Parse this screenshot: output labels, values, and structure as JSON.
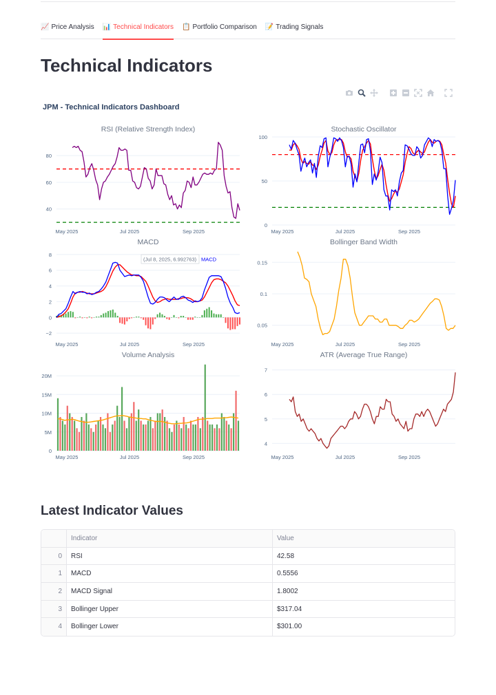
{
  "tabs": [
    {
      "icon": "📈",
      "label": "Price Analysis"
    },
    {
      "icon": "📊",
      "label": "Technical Indicators"
    },
    {
      "icon": "📋",
      "label": "Portfolio Comparison"
    },
    {
      "icon": "📝",
      "label": "Trading Signals"
    }
  ],
  "active_tab": 1,
  "page_title": "Technical Indicators",
  "dashboard_title": "JPM - Technical Indicators Dashboard",
  "modebar_icons": [
    "camera-icon",
    "zoom-icon",
    "pan-icon",
    "zoom-in-icon",
    "zoom-out-icon",
    "autoscale-icon",
    "reset-axes-icon",
    "fullscreen-icon"
  ],
  "hover_tooltip": {
    "text": "(Jul 8, 2025, 6.992763)",
    "series": "MACD"
  },
  "colors": {
    "accent": "#ff4b4b",
    "rsi": "#800080",
    "stoch_k": "#0000ff",
    "stoch_d": "#ff0000",
    "macd": "#0000ff",
    "signal": "#ff0000",
    "hist_pos": "#4caf50",
    "hist_neg": "#ff5252",
    "bbw": "#ffa500",
    "volume_ma": "#ffa500",
    "atr": "#a52a2a",
    "overbought": "#ff0000",
    "oversold": "#008000"
  },
  "chart_data": [
    {
      "type": "line",
      "title": "RSI (Relative Strength Index)",
      "x_ticks": [
        "May 2025",
        "Jul 2025",
        "Sep 2025"
      ],
      "y_ticks": [
        40,
        60,
        80
      ],
      "ylim": [
        28,
        94
      ],
      "reference_lines": [
        {
          "value": 70,
          "color": "#ff0000",
          "style": "dashed"
        },
        {
          "value": 30,
          "color": "#008000",
          "style": "dashed"
        }
      ],
      "series": [
        {
          "values": [
            86,
            87,
            86,
            87,
            84,
            83,
            75,
            64,
            66,
            71,
            74,
            69,
            62,
            58,
            47,
            55,
            60,
            61,
            64,
            66,
            69,
            72,
            74,
            79,
            86,
            84,
            84,
            85,
            84,
            69,
            69,
            61,
            60,
            56,
            55,
            57,
            64,
            71,
            70,
            63,
            61,
            55,
            58,
            70,
            65,
            65,
            65,
            59,
            58,
            51,
            47,
            50,
            43,
            44,
            40,
            43,
            41,
            52,
            54,
            61,
            60,
            56,
            64,
            58,
            58,
            60,
            63,
            66,
            67,
            66,
            66,
            67,
            66,
            69,
            70,
            90,
            88,
            84,
            65,
            57,
            52,
            53,
            41,
            34,
            33,
            44,
            39
          ]
        }
      ]
    },
    {
      "type": "line",
      "title": "Stochastic Oscillator",
      "x_ticks": [
        "May 2025",
        "Jul 2025",
        "Sep 2025"
      ],
      "y_ticks": [
        0,
        50,
        100
      ],
      "ylim": [
        0,
        100
      ],
      "reference_lines": [
        {
          "value": 80,
          "color": "#ff0000",
          "style": "dashed"
        },
        {
          "value": 20,
          "color": "#008000",
          "style": "dashed"
        }
      ],
      "series": [
        {
          "values": [
            91,
            86,
            96,
            93,
            86,
            80,
            61,
            70,
            76,
            66,
            71,
            74,
            59,
            70,
            54,
            78,
            90,
            88,
            98,
            99,
            66,
            77,
            86,
            99,
            98,
            95,
            99,
            96,
            88,
            66,
            78,
            78,
            69,
            43,
            58,
            49,
            71,
            91,
            92,
            82,
            97,
            98,
            84,
            46,
            58,
            51,
            60,
            77,
            71,
            40,
            33,
            33,
            17,
            40,
            38,
            40,
            33,
            49,
            59,
            62,
            91,
            90,
            86,
            81,
            79,
            79,
            89,
            86,
            76,
            79,
            91,
            95,
            99,
            97,
            89,
            97,
            95,
            96,
            94,
            85,
            64,
            64,
            33,
            12,
            19,
            28,
            51
          ]
        },
        {
          "values": [
            85,
            85,
            91,
            93,
            90,
            86,
            75,
            70,
            72,
            70,
            69,
            72,
            68,
            68,
            63,
            68,
            78,
            85,
            93,
            96,
            84,
            80,
            82,
            91,
            96,
            97,
            97,
            97,
            93,
            83,
            77,
            78,
            75,
            61,
            55,
            50,
            59,
            74,
            85,
            89,
            93,
            96,
            92,
            75,
            62,
            52,
            56,
            63,
            69,
            62,
            47,
            35,
            27,
            30,
            35,
            39,
            37,
            41,
            49,
            57,
            71,
            81,
            89,
            87,
            82,
            80,
            83,
            85,
            83,
            81,
            83,
            89,
            94,
            97,
            94,
            93,
            95,
            96,
            95,
            91,
            80,
            70,
            52,
            36,
            24,
            20,
            33
          ]
        }
      ]
    },
    {
      "type": "line",
      "title": "MACD",
      "x_ticks": [
        "May 2025",
        "Jul 2025",
        "Sep 2025"
      ],
      "y_ticks": [
        -2,
        0,
        2,
        4,
        6,
        8
      ],
      "ylim": [
        -2.6,
        8.6
      ],
      "series": [
        {
          "name": "MACD",
          "values": [
            0,
            0.4,
            0.5,
            0.8,
            1.1,
            1.8,
            2.6,
            3.3,
            3.0,
            3.2,
            3.3,
            3.2,
            3.2,
            3.0,
            3.1,
            2.9,
            3.0,
            3.2,
            3.3,
            3.6,
            4.0,
            4.5,
            5.3,
            6.1,
            6.9,
            7.0,
            6.9,
            6.0,
            5.6,
            5.2,
            5.3,
            5.4,
            5.3,
            5.4,
            5.4,
            5.4,
            5.1,
            4.6,
            3.6,
            2.6,
            1.8,
            1.7,
            1.9,
            2.3,
            2.6,
            2.6,
            2.5,
            2.2,
            2.0,
            2.3,
            2.6,
            2.3,
            2.3,
            2.6,
            2.7,
            2.5,
            2.2,
            2.1,
            1.9,
            2.1,
            2.0,
            2.1,
            2.5,
            3.5,
            4.3,
            5.1,
            5.3,
            5.3,
            5.3,
            5.3,
            5.2,
            4.6,
            3.7,
            2.6,
            1.8,
            1.3,
            0.6,
            0.5,
            0.6
          ]
        },
        {
          "name": "Signal",
          "values": [
            0,
            0.1,
            0.2,
            0.4,
            0.7,
            1.1,
            1.8,
            2.6,
            3.1,
            3.2,
            3.2,
            3.3,
            3.2,
            3.1,
            3.0,
            3.0,
            3.0,
            3.1,
            3.2,
            3.3,
            3.5,
            3.9,
            4.5,
            5.2,
            5.9,
            6.4,
            6.7,
            6.7,
            6.4,
            6.1,
            5.8,
            5.6,
            5.4,
            5.4,
            5.3,
            5.3,
            5.2,
            4.9,
            4.6,
            4.0,
            3.3,
            2.6,
            2.1,
            1.9,
            2.0,
            2.2,
            2.3,
            2.4,
            2.3,
            2.3,
            2.3,
            2.3,
            2.4,
            2.4,
            2.5,
            2.5,
            2.5,
            2.4,
            2.2,
            2.0,
            2.0,
            2.1,
            2.2,
            2.6,
            3.2,
            3.8,
            4.4,
            4.8,
            4.9,
            4.9,
            4.8,
            4.6,
            4.4,
            4.0,
            3.4,
            2.8,
            2.1,
            1.6,
            1.5
          ]
        },
        {
          "name": "Histogram",
          "values": [
            0.2,
            0.3,
            0.3,
            0.4,
            0.5,
            0.7,
            0.8,
            0.7,
            -0.1,
            0,
            0.1,
            -0.1,
            0,
            -0.1,
            0.1,
            -0.1,
            0,
            0.1,
            0.1,
            0.3,
            0.5,
            0.6,
            0.8,
            0.9,
            1.0,
            0.6,
            0.2,
            -0.7,
            -0.8,
            -0.9,
            -0.5,
            -0.2,
            -0.1,
            0,
            0.1,
            0.1,
            -0.1,
            -0.3,
            -1.0,
            -1.4,
            -1.5,
            -0.9,
            -0.2,
            0.4,
            0.6,
            0.4,
            0.2,
            -0.2,
            -0.3,
            0,
            0.3,
            0,
            -0.1,
            0.2,
            0.2,
            0,
            -0.3,
            -0.3,
            -0.3,
            0.1,
            0,
            0,
            0.3,
            0.9,
            1.1,
            1.3,
            0.9,
            0.5,
            0.4,
            0.4,
            0.4,
            0,
            -0.7,
            -1.4,
            -1.6,
            -1.5,
            -1.5,
            -1.1,
            -0.9
          ]
        }
      ]
    },
    {
      "type": "line",
      "title": "Bollinger Band Width",
      "x_ticks": [
        "May 2025",
        "Jul 2025",
        "Sep 2025"
      ],
      "y_ticks": [
        0.05,
        0.1,
        0.15
      ],
      "ylim": [
        0.03,
        0.17
      ],
      "series": [
        {
          "values": [
            0.167,
            0.158,
            0.145,
            0.125,
            0.123,
            0.119,
            0.1,
            0.09,
            0.08,
            0.06,
            0.045,
            0.035,
            0.037,
            0.037,
            0.04,
            0.05,
            0.06,
            0.08,
            0.105,
            0.125,
            0.155,
            0.155,
            0.145,
            0.125,
            0.095,
            0.07,
            0.06,
            0.05,
            0.05,
            0.055,
            0.06,
            0.065,
            0.065,
            0.065,
            0.06,
            0.06,
            0.055,
            0.055,
            0.06,
            0.06,
            0.05,
            0.05,
            0.05,
            0.05,
            0.048,
            0.045,
            0.045,
            0.05,
            0.053,
            0.058,
            0.058,
            0.055,
            0.057,
            0.06,
            0.065,
            0.07,
            0.075,
            0.08,
            0.085,
            0.088,
            0.092,
            0.092,
            0.09,
            0.08,
            0.065,
            0.045,
            0.042,
            0.045,
            0.045,
            0.05
          ]
        }
      ]
    },
    {
      "type": "bar",
      "title": "Volume Analysis",
      "x_ticks": [
        "May 2025",
        "Jul 2025",
        "Sep 2025"
      ],
      "y_ticks": [
        "0",
        "5M",
        "10M",
        "15M",
        "20M"
      ],
      "ylim": [
        0,
        23.5
      ],
      "series": [
        {
          "name": "Volume",
          "values": [
            14,
            9,
            8,
            7,
            12,
            10,
            9,
            8,
            6,
            5,
            9,
            8,
            10,
            7,
            6,
            5,
            7,
            8,
            9,
            7,
            6,
            10,
            5,
            7,
            8,
            12,
            9,
            17,
            8,
            6,
            9,
            10,
            13,
            8,
            11,
            8,
            7,
            7,
            8,
            9,
            6,
            8,
            10,
            10,
            11,
            9,
            8,
            6,
            5,
            7,
            8,
            7,
            6,
            9,
            7,
            6,
            8,
            7,
            7,
            9,
            6,
            9,
            23,
            8,
            7,
            7,
            6,
            7,
            6,
            10,
            9,
            8,
            7,
            6,
            10,
            16,
            8
          ],
          "up": [
            true,
            false,
            true,
            true,
            false,
            true,
            false,
            true,
            false,
            false,
            true,
            false,
            true,
            true,
            false,
            true,
            false,
            true,
            false,
            true,
            true,
            false,
            false,
            true,
            false,
            true,
            true,
            true,
            false,
            true,
            true,
            false,
            false,
            true,
            true,
            false,
            true,
            false,
            true,
            true,
            false,
            false,
            true,
            true,
            false,
            true,
            false,
            true,
            true,
            false,
            true,
            false,
            true,
            false,
            true,
            false,
            false,
            true,
            true,
            false,
            true,
            false,
            true,
            false,
            true,
            true,
            false,
            true,
            false,
            true,
            true,
            false,
            true,
            false,
            true,
            false,
            true
          ]
        },
        {
          "name": "Volume MA",
          "values": [
            8.5,
            8.5,
            8.3,
            8.1,
            8.3,
            8.2,
            8.4,
            8.3,
            8.1,
            7.9,
            7.8,
            7.6,
            7.6,
            7.6,
            7.7,
            7.8,
            7.9,
            8.0,
            8.1,
            8.2,
            8.4,
            8.6,
            8.8,
            9.0,
            9.2,
            9.3,
            9.3,
            9.4,
            9.3,
            9.2,
            9.0,
            8.9,
            8.8,
            8.7,
            8.6,
            8.6,
            8.5,
            8.5,
            8.3,
            8.1,
            8.0,
            7.8,
            7.8,
            7.8,
            7.8,
            7.6,
            7.4,
            7.3,
            7.2,
            7.2,
            7.2,
            7.3,
            7.3,
            7.4,
            7.4,
            7.5,
            7.7,
            7.9,
            8.1,
            8.3,
            8.4,
            8.4,
            8.5,
            8.6,
            8.6,
            8.6,
            8.7,
            8.7,
            8.7,
            8.7,
            8.8,
            8.8,
            8.9,
            9.0,
            8.9,
            8.8,
            8.7
          ]
        }
      ]
    },
    {
      "type": "line",
      "title": "ATR (Average True Range)",
      "x_ticks": [
        "May 2025",
        "Jul 2025",
        "Sep 2025"
      ],
      "y_ticks": [
        4,
        5,
        6,
        7
      ],
      "ylim": [
        3.7,
        7.3
      ],
      "series": [
        {
          "values": [
            5.8,
            5.7,
            5.9,
            5.3,
            5.1,
            5.2,
            4.9,
            5.0,
            4.8,
            4.6,
            4.5,
            4.6,
            4.5,
            4.4,
            4.2,
            4.1,
            4.2,
            4.0,
            3.9,
            3.8,
            3.9,
            4.2,
            4.3,
            4.4,
            4.5,
            4.6,
            4.7,
            4.7,
            4.6,
            4.7,
            4.9,
            5.0,
            5.0,
            5.3,
            5.2,
            5.0,
            5.1,
            5.4,
            5.6,
            5.6,
            5.5,
            5.3,
            5.0,
            4.8,
            5.1,
            5.1,
            5.5,
            5.4,
            5.4,
            5.8,
            5.7,
            5.7,
            5.2,
            5.1,
            4.9,
            5.0,
            4.8,
            4.7,
            4.6,
            4.9,
            4.5,
            4.6,
            4.6,
            5.0,
            5.2,
            5.2,
            5.1,
            5.3,
            5.1,
            5.3,
            5.4,
            5.3,
            5.1,
            4.9,
            4.7,
            4.8,
            5.0,
            5.2,
            5.4,
            5.3,
            5.6,
            5.7,
            5.8,
            6.1,
            6.9
          ]
        }
      ]
    }
  ],
  "table": {
    "title": "Latest Indicator Values",
    "columns": [
      "",
      "Indicator",
      "Value"
    ],
    "rows": [
      [
        "0",
        "RSI",
        "42.58"
      ],
      [
        "1",
        "MACD",
        "0.5556"
      ],
      [
        "2",
        "MACD Signal",
        "1.8002"
      ],
      [
        "3",
        "Bollinger Upper",
        "$317.04"
      ],
      [
        "4",
        "Bollinger Lower",
        "$301.00"
      ]
    ]
  }
}
